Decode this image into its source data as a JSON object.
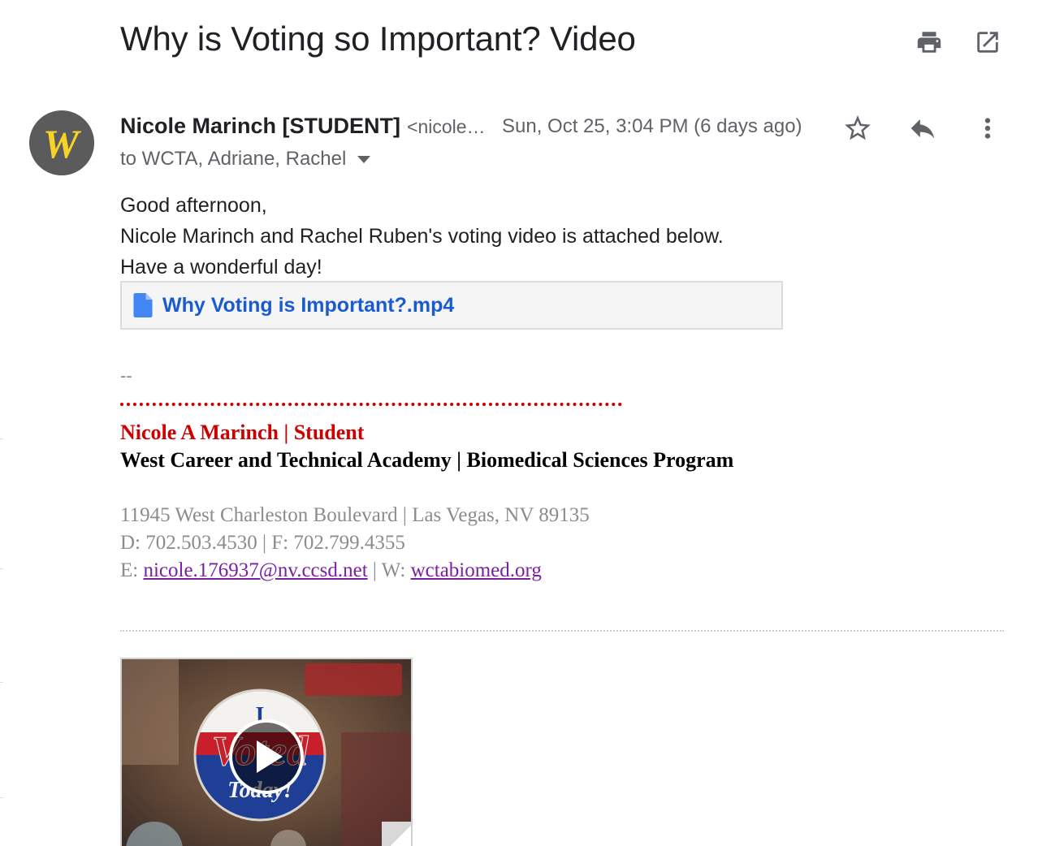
{
  "email": {
    "subject": "Why is Voting so Important? Video",
    "sender_name": "Nicole Marinch [STUDENT]",
    "sender_email": "<nicole…",
    "timestamp": "Sun, Oct 25, 3:04 PM (6 days ago)",
    "recipients": "to WCTA, Adriane, Rachel",
    "body_lines": [
      "Good afternoon,",
      "Nicole Marinch and Rachel Ruben's voting video is attached below.",
      "Have a wonderful day!"
    ],
    "attachment_name": "Why Voting is Important?.mp4"
  },
  "signature": {
    "dash": "--",
    "name_line": "Nicole A Marinch | Student",
    "school_line": "West Career and Technical Academy | Biomedical Sciences Program",
    "address": "11945 West Charleston Boulevard | Las Vegas, NV 89135",
    "phones": "D: 702.503.4530 | F: 702.799.4355",
    "email_label": "E: ",
    "email_link": "nicole.176937@nv.ccsd.net",
    "web_label": " | W: ",
    "web_link": "wctabiomed.org"
  },
  "video": {
    "sticker_line1": "I",
    "sticker_line2": "Voted",
    "sticker_line3": "Today!"
  },
  "avatar": {
    "letter": "W",
    "color": "#f5d327"
  },
  "icons": [
    "print-icon",
    "open-in-new-icon",
    "star-icon",
    "reply-icon",
    "more-vert-icon",
    "dropdown-caret-icon",
    "file-icon",
    "play-icon"
  ],
  "colors": {
    "accent_link": "#1a5ccf",
    "signature_red": "#cc0000",
    "visited_link": "#7b1fa2"
  }
}
